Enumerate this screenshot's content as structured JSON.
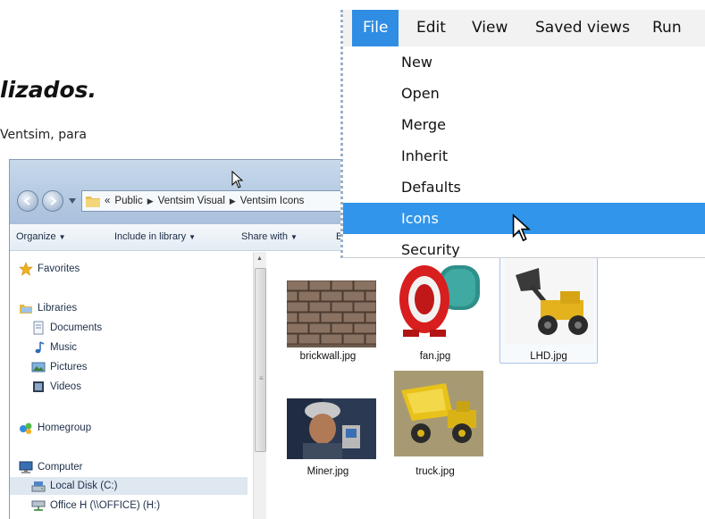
{
  "document": {
    "heading": "lizados.",
    "text": "Ventsim, para"
  },
  "explorer": {
    "breadcrumb": [
      "«",
      "Public",
      "Ventsim Visual",
      "Ventsim Icons"
    ],
    "toolbar": {
      "organize": "Organize",
      "include_in_library": "Include in library",
      "share_with": "Share with",
      "truncated": "B"
    },
    "sidebar": {
      "favorites": "Favorites",
      "libraries": "Libraries",
      "documents": "Documents",
      "music": "Music",
      "pictures": "Pictures",
      "videos": "Videos",
      "homegroup": "Homegroup",
      "computer": "Computer",
      "local_disk": "Local Disk (C:)",
      "office_drive": "Office H (\\\\OFFICE) (H:)"
    },
    "files": [
      {
        "name": "brickwall.jpg",
        "selected": false
      },
      {
        "name": "fan.jpg",
        "selected": false
      },
      {
        "name": "LHD.jpg",
        "selected": true
      },
      {
        "name": "Miner.jpg",
        "selected": false
      },
      {
        "name": "truck.jpg",
        "selected": false
      }
    ]
  },
  "menu": {
    "bar": [
      "File",
      "Edit",
      "View",
      "Saved views",
      "Run"
    ],
    "active": "File",
    "items": [
      "New",
      "Open",
      "Merge",
      "Inherit",
      "Defaults",
      "Icons",
      "Security"
    ],
    "highlighted": "Icons"
  },
  "colors": {
    "menu_active": "#2f8de4",
    "menu_highlight": "#3195eb",
    "selection": "#dfe7f1"
  }
}
